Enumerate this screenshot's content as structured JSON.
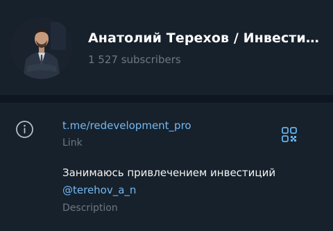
{
  "channel": {
    "title": "Анатолий Терехов / Инвестиции…",
    "subscribers": "1 527 subscribers"
  },
  "info": {
    "link_value": "t.me/redevelopment_pro",
    "link_label": "Link",
    "description_text": "Занимаюсь привлечением инвестиций",
    "description_mention": "@terehov_a_n",
    "description_label": "Description"
  },
  "icons": {
    "info": "info-icon",
    "qr": "qr-code-icon"
  },
  "colors": {
    "background": "#17212b",
    "divider": "#0e1621",
    "accent": "#73b9f5",
    "muted": "#6d7883",
    "qr": "#64b5ef"
  }
}
